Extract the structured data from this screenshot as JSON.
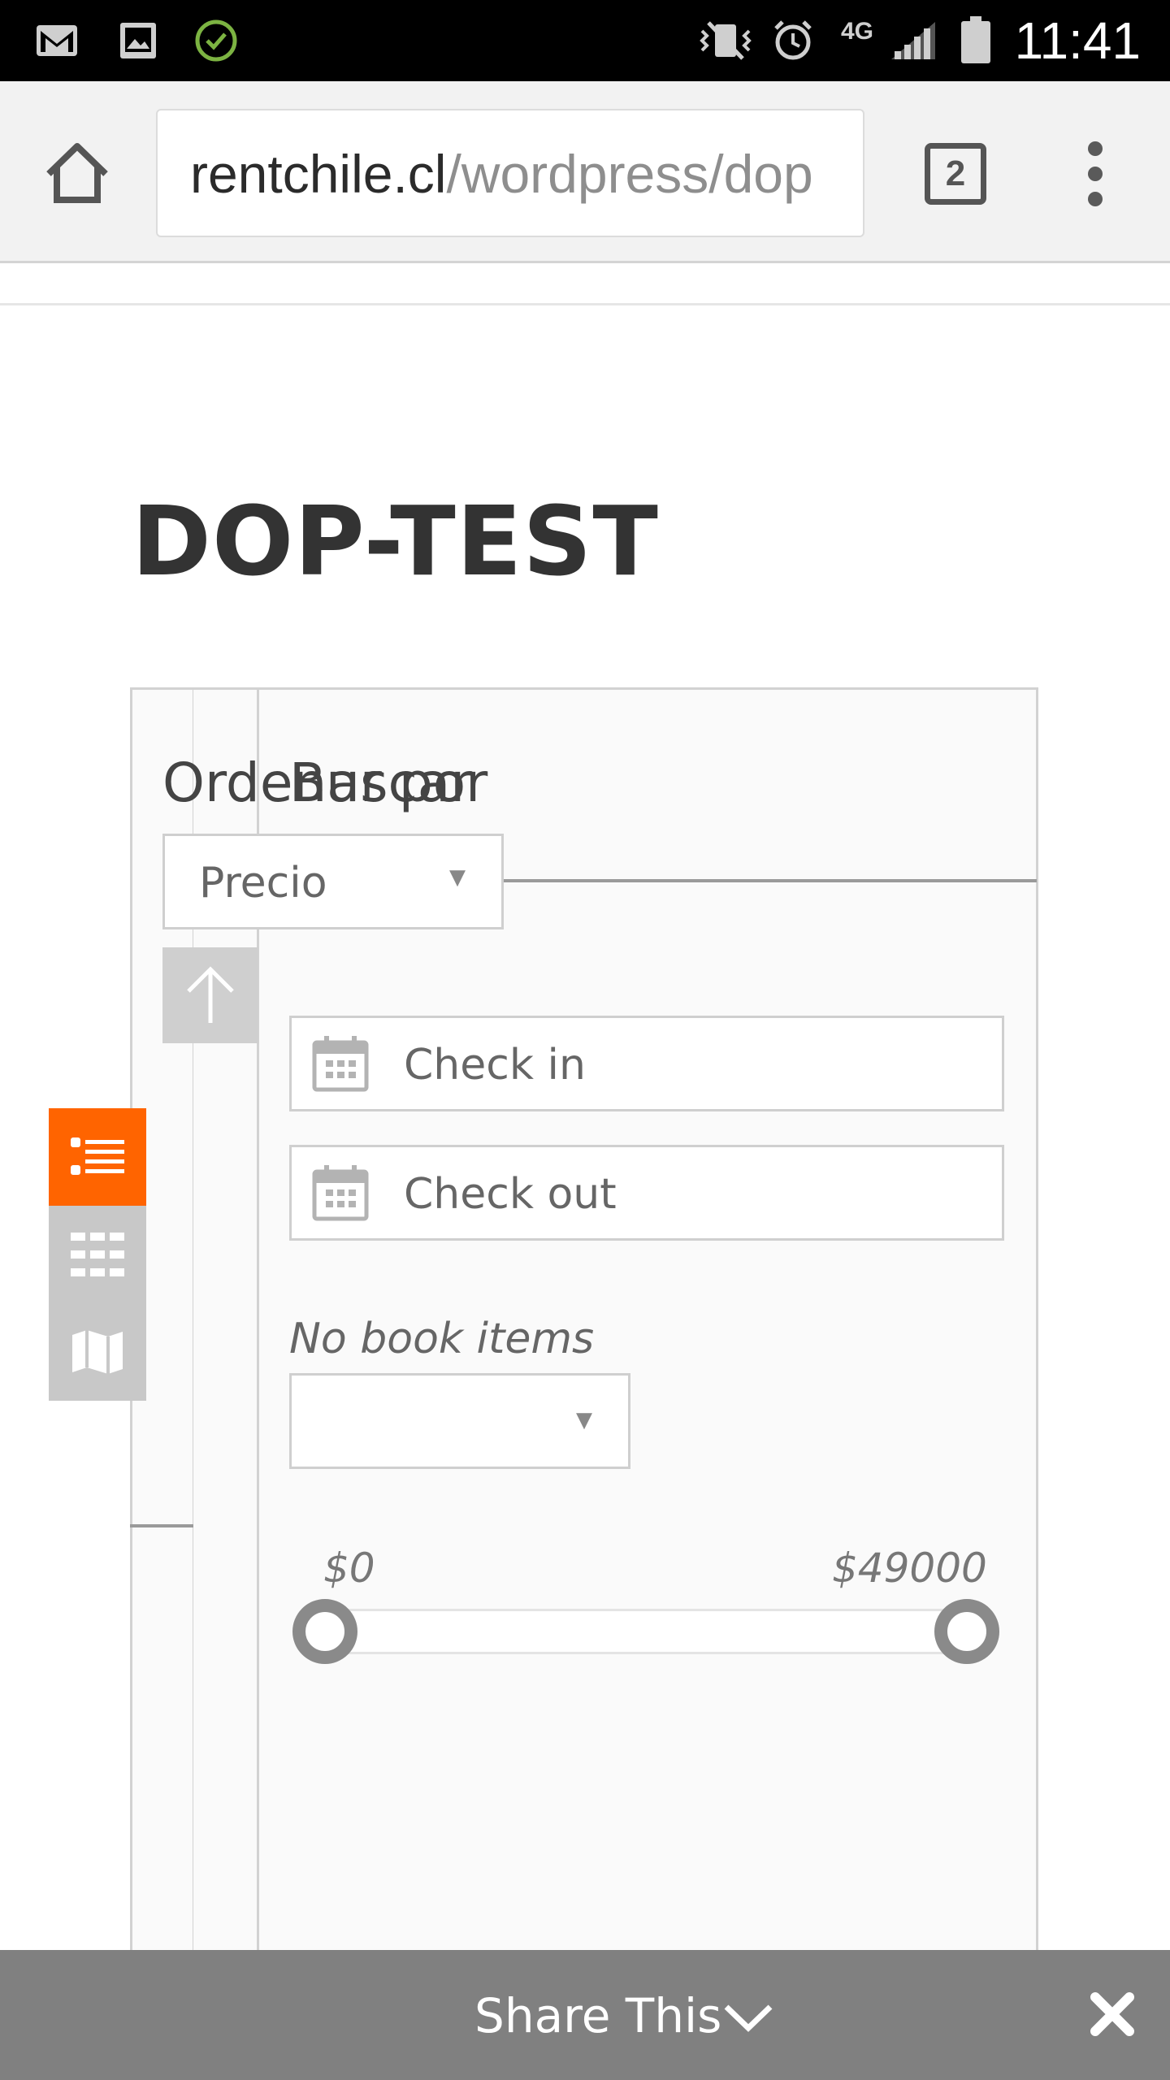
{
  "status_bar": {
    "time": "11:41",
    "network": "4G",
    "icons": [
      "gmail-icon",
      "gallery-icon",
      "check-circle-icon",
      "vibrate-mute-icon",
      "alarm-icon",
      "signal-icon",
      "battery-icon"
    ]
  },
  "browser": {
    "url_domain": "rentchile.cl",
    "url_path": "/wordpress/dop",
    "tab_count": "2"
  },
  "page": {
    "title": "DOP-TEST"
  },
  "sort": {
    "label": "Ordenar por",
    "selected": "Precio"
  },
  "search": {
    "title": "Buscar",
    "check_in_placeholder": "Check in",
    "check_out_placeholder": "Check out",
    "no_items_label": "No book items",
    "price_min": "$0",
    "price_max": "$49000",
    "range_min_fraction": 0,
    "range_max_fraction": 1
  },
  "view_switcher": {
    "active": "list",
    "options": [
      "list-view-icon",
      "grid-view-icon",
      "map-view-icon"
    ]
  },
  "share_bar": {
    "label": "Share This"
  },
  "colors": {
    "accent": "#ff6400",
    "share_bar": "#808080",
    "inactive_button": "#c8c8c8"
  }
}
